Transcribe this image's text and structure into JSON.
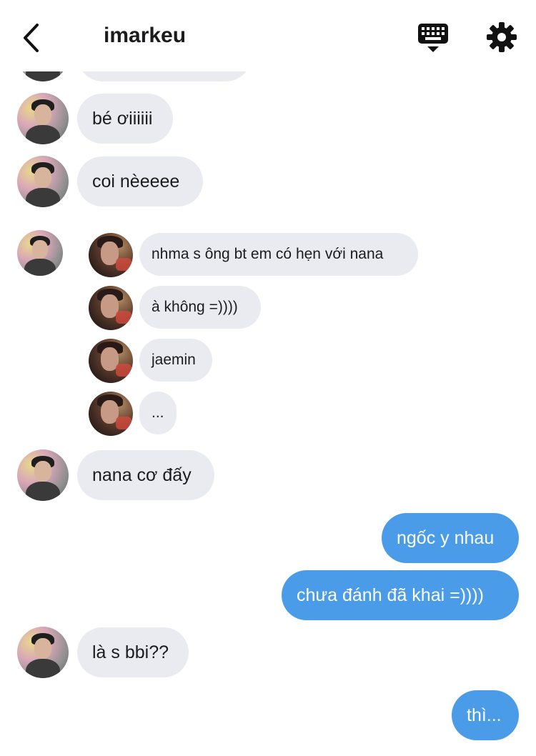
{
  "header": {
    "title": "imarkeu"
  },
  "icons": {
    "back": "chevron-left-icon",
    "keyboard": "keyboard-icon",
    "settings": "gear-icon"
  },
  "colors": {
    "incoming_bubble": "#e9ebf0",
    "outgoing_bubble": "#4a9be8",
    "text": "#1c1c1e"
  },
  "messages": [
    {
      "text": "bé ơiiiiii",
      "sender": "other"
    },
    {
      "text": "coi nèeeee",
      "sender": "other"
    },
    {
      "text": "nana cơ đấy",
      "sender": "other"
    },
    {
      "text": "ngốc y nhau",
      "sender": "me"
    },
    {
      "text": "chưa đánh đã khai =))))",
      "sender": "me"
    },
    {
      "text": "là s bbi??",
      "sender": "other"
    },
    {
      "text": "thì...",
      "sender": "me"
    }
  ],
  "quoted": [
    {
      "text": "nhma s ông bt em có hẹn với nana"
    },
    {
      "text": "à không =))))"
    },
    {
      "text": "jaemin"
    },
    {
      "text": "..."
    }
  ]
}
